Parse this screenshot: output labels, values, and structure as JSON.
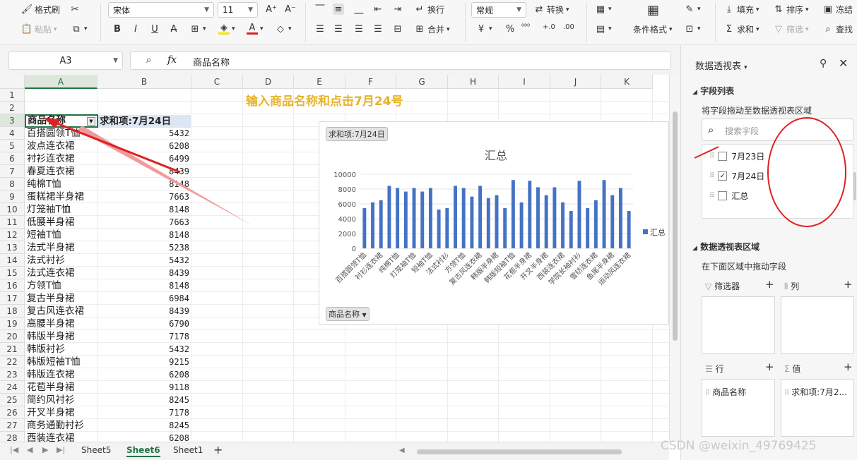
{
  "ribbon": {
    "format_painter": "格式刷",
    "paste": "粘贴",
    "font_name": "宋体",
    "font_size": "11",
    "wrap": "换行",
    "merge": "合并",
    "number_format": "常规",
    "convert": "转换",
    "cond_format": "条件格式",
    "fill": "填充",
    "sort": "排序",
    "freeze": "冻结",
    "sum": "求和",
    "filter": "筛选",
    "find": "查找"
  },
  "formula": {
    "cell_ref": "A3",
    "fx": "fx",
    "value": "商品名称"
  },
  "columns": [
    "A",
    "B",
    "C",
    "D",
    "E",
    "F",
    "G",
    "H",
    "I",
    "J",
    "K"
  ],
  "rows": [
    "1",
    "2",
    "3",
    "4",
    "5",
    "6",
    "7",
    "8",
    "9",
    "10",
    "11",
    "12",
    "13",
    "14",
    "15",
    "16",
    "17",
    "18",
    "19",
    "20",
    "21",
    "22",
    "23",
    "24",
    "25",
    "26",
    "27",
    "28"
  ],
  "annotation": "输入商品名称和点击7月24号",
  "pivot": {
    "header_a": "商品名称",
    "header_b": "求和项:7月24日",
    "names": [
      "百搭圆领T恤",
      "波点连衣裙",
      "衬衫连衣裙",
      "春夏连衣裙",
      "纯棉T恤",
      "蛋糕裙半身裙",
      "灯笼袖T恤",
      "低腰半身裙",
      "短袖T恤",
      "法式半身裙",
      "法式衬衫",
      "法式连衣裙",
      "方领T恤",
      "复古半身裙",
      "复古风连衣裙",
      "高腰半身裙",
      "韩版半身裙",
      "韩版衬衫",
      "韩版短袖T恤",
      "韩版连衣裙",
      "花苞半身裙",
      "简约风衬衫",
      "开叉半身裙",
      "商务通勤衬衫",
      "西装连衣裙"
    ],
    "values": [
      "5432",
      "6208",
      "6499",
      "8439",
      "8148",
      "7663",
      "8148",
      "7663",
      "8148",
      "5238",
      "5432",
      "8439",
      "8148",
      "6984",
      "8439",
      "6790",
      "7178",
      "5432",
      "9215",
      "6208",
      "9118",
      "8245",
      "7178",
      "8245",
      "6208"
    ]
  },
  "chart_data": {
    "type": "bar",
    "title": "汇总",
    "value_chip": "求和项:7月24日",
    "axis_chip": "商品名称",
    "legend": "汇总",
    "ylim": [
      0,
      10000
    ],
    "yticks": [
      "0",
      "2000",
      "4000",
      "6000",
      "8000",
      "10000"
    ],
    "categories": [
      "百搭圆领T恤",
      "衬衫连衣裙",
      "纯棉T恤",
      "灯笼袖T恤",
      "短袖T恤",
      "法式衬衫",
      "方领T恤",
      "复古风连衣裙",
      "韩版半身裙",
      "韩版短袖T恤",
      "花苞半身裙",
      "开叉半身裙",
      "西装连衣裙",
      "学院长袖衬衫",
      "雪纺连衣裙",
      "鱼尾半身裙",
      "运动风连衣裙"
    ],
    "values": [
      5432,
      6208,
      6499,
      8439,
      8148,
      7663,
      8148,
      7663,
      8148,
      5238,
      5432,
      8439,
      8148,
      6984,
      8439,
      6790,
      7178,
      5432,
      9215,
      6208,
      9118,
      8245,
      7178,
      8245,
      6208,
      5044,
      9118,
      5432,
      6499,
      9215,
      7178,
      8148,
      5044
    ]
  },
  "sheets": [
    "Sheet5",
    "Sheet6",
    "Sheet1"
  ],
  "active_sheet": "Sheet6",
  "panel": {
    "title": "数据透视表",
    "field_list": "字段列表",
    "drag_hint": "将字段拖动至数据透视表区域",
    "search_placeholder": "搜索字段",
    "fields": [
      {
        "label": "7月23日",
        "checked": false
      },
      {
        "label": "7月24日",
        "checked": true
      },
      {
        "label": "汇总",
        "checked": false
      }
    ],
    "areas_title": "数据透视表区域",
    "areas_hint": "在下面区域中拖动字段",
    "filter_label": "筛选器",
    "columns_label": "列",
    "rows_label": "行",
    "values_label": "值",
    "row_field": "商品名称",
    "value_field": "求和项:7月2..."
  },
  "watermark": "CSDN @weixin_49769425",
  "colors": {
    "accent": "#217346",
    "bar": "#4472c4",
    "annotation": "#e6b32b",
    "marker": "#e02020"
  }
}
